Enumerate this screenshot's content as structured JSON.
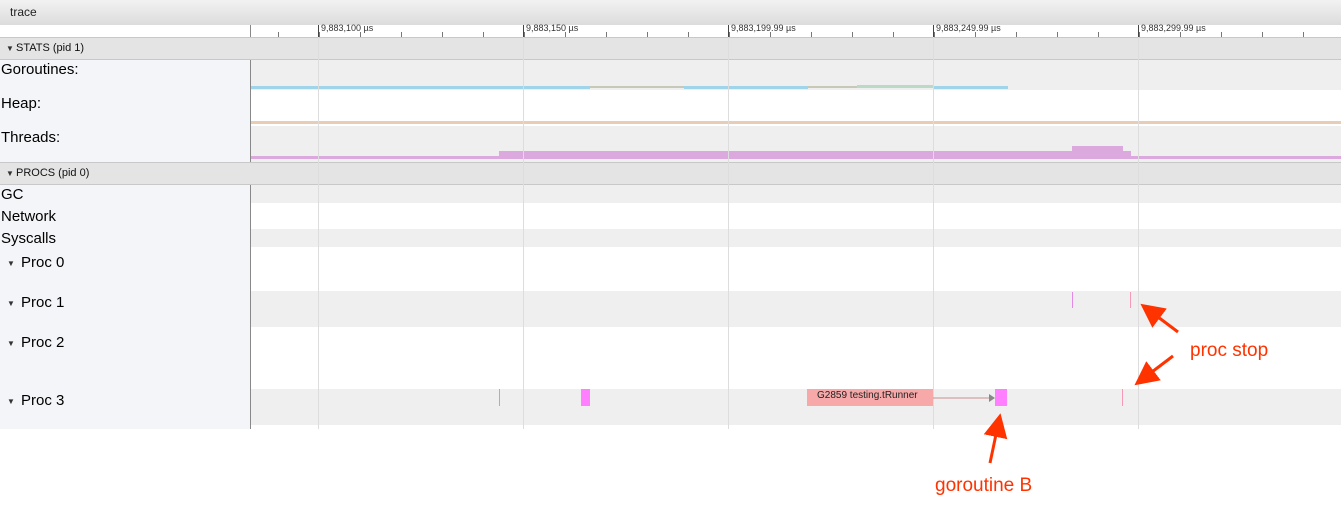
{
  "window": {
    "title": "trace"
  },
  "ruler": {
    "ticks": [
      {
        "label": "9,883,100 µs"
      },
      {
        "label": "9,883,150 µs"
      },
      {
        "label": "9,883,199.99 µs"
      },
      {
        "label": "9,883,249.99 µs"
      },
      {
        "label": "9,883,299.99 µs"
      }
    ]
  },
  "stats_section": {
    "title": "STATS (pid 1)",
    "tracks": {
      "goroutines": "Goroutines:",
      "heap": "Heap:",
      "threads": "Threads:"
    }
  },
  "procs_section": {
    "title": "PROCS (pid 0)",
    "tracks": {
      "gc": "GC",
      "network": "Network",
      "syscalls": "Syscalls"
    },
    "procs": [
      "Proc 0",
      "Proc 1",
      "Proc 2",
      "Proc 3"
    ]
  },
  "slices": {
    "goroutine_slice": "G2859 testing.tRunner"
  },
  "annotations": {
    "proc_stop": "proc stop",
    "goroutine_b": "goroutine B"
  },
  "colors": {
    "goroutine_slice": "#f7a8a8",
    "goroutine_b": "#ff7fff",
    "annotation": "#ff3300",
    "threads_counter": "#dba9dd",
    "heap_counter": "#e8cdb4",
    "goroutines_counter": "#9fd4ea"
  }
}
